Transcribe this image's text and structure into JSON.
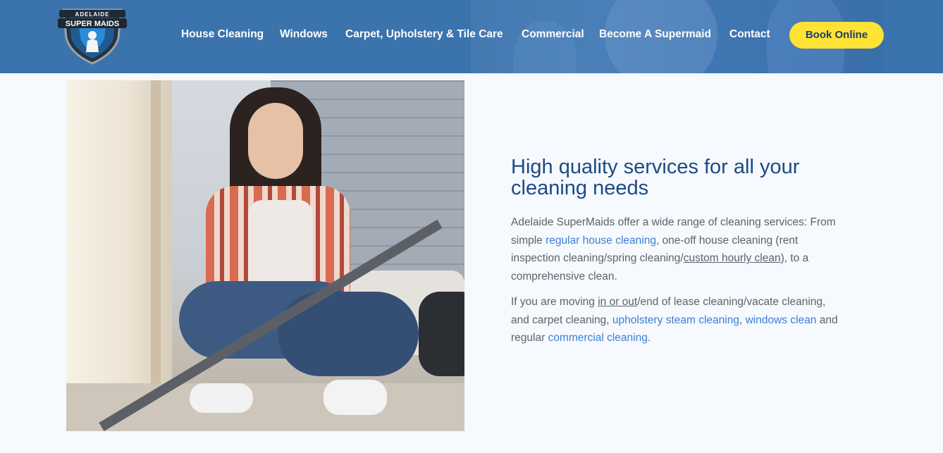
{
  "brand": {
    "logo_line1": "ADELAIDE",
    "logo_line2": "SUPER MAIDS",
    "colors": {
      "header_bg": "#3b73ad",
      "accent_yellow": "#ffe334",
      "heading_blue": "#1d4a86",
      "link_blue": "#3a7fd6",
      "body_text": "#5c636b"
    }
  },
  "nav": {
    "items": [
      {
        "label": "House Cleaning"
      },
      {
        "label": "Windows"
      },
      {
        "label": "Carpet, Upholstery & Tile Care"
      },
      {
        "label": "Commercial"
      },
      {
        "label": "Become A Supermaid"
      },
      {
        "label": "Contact"
      }
    ],
    "cta_label": "Book Online"
  },
  "main": {
    "heading": "High quality services for all your cleaning needs",
    "p1": {
      "t1": "Adelaide SuperMaids offer a wide range of cleaning services: From simple ",
      "link1": "regular house cleaning",
      "t2": ", one-off house cleaning (rent inspection cleaning/spring cleaning/",
      "link2": "custom hourly clean",
      "t3": "), to a comprehensive clean."
    },
    "p2": {
      "t1": "If you are moving ",
      "link1": "in or out",
      "t2": "/end of lease cleaning/vacate cleaning, and carpet cleaning, ",
      "link2": "upholstery steam cleaning",
      "t3": ", ",
      "link3": "windows clean",
      "t4": " and regular ",
      "link4": "commercial cleaning",
      "t5": "."
    }
  }
}
